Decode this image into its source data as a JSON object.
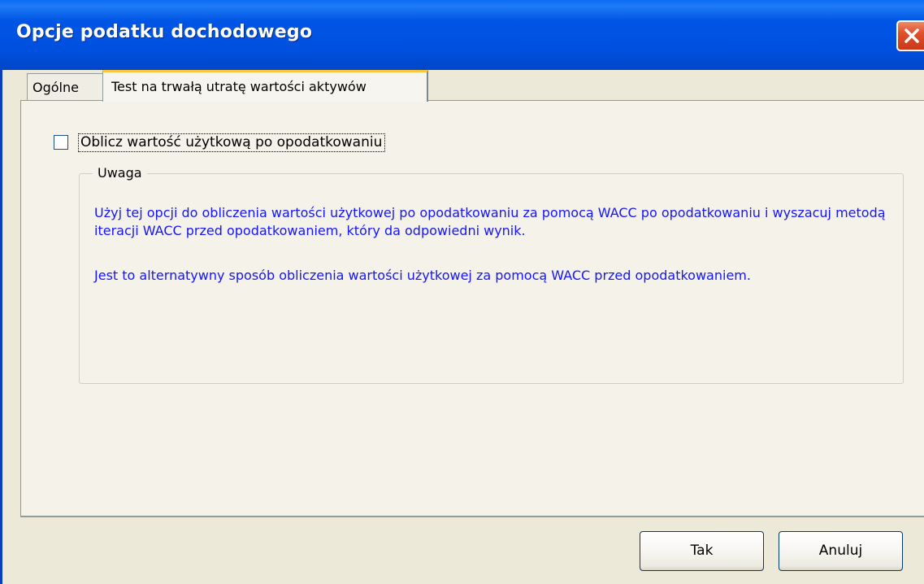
{
  "window": {
    "title": "Opcje podatku dochodowego"
  },
  "tabs": [
    {
      "label": "Ogólne",
      "selected": false
    },
    {
      "label": "Test na trwałą utratę wartości aktywów",
      "selected": true
    }
  ],
  "option": {
    "label": "Oblicz wartość użytkową po opodatkowaniu",
    "checked": false
  },
  "group": {
    "title": "Uwaga",
    "paragraphs": [
      "Użyj tej opcji do obliczenia wartości użytkowej po opodatkowaniu za pomocą WACC po opodatkowaniu i wyszacuj metodą iteracji WACC przed opodatkowaniem, który da odpowiedni wynik.",
      "Jest to alternatywny sposób obliczenia wartości użytkowej za pomocą WACC przed opodatkowaniem."
    ]
  },
  "buttons": {
    "ok_label": "Tak",
    "cancel_label": "Anuluj"
  },
  "colors": {
    "titlebar": "#0055e5",
    "note_text": "#1515ff",
    "dialog_bg": "#ece9d8",
    "tab_highlight": "#ffc83c"
  },
  "icons": {
    "close": "close-icon",
    "checkbox": "checkbox-icon"
  }
}
